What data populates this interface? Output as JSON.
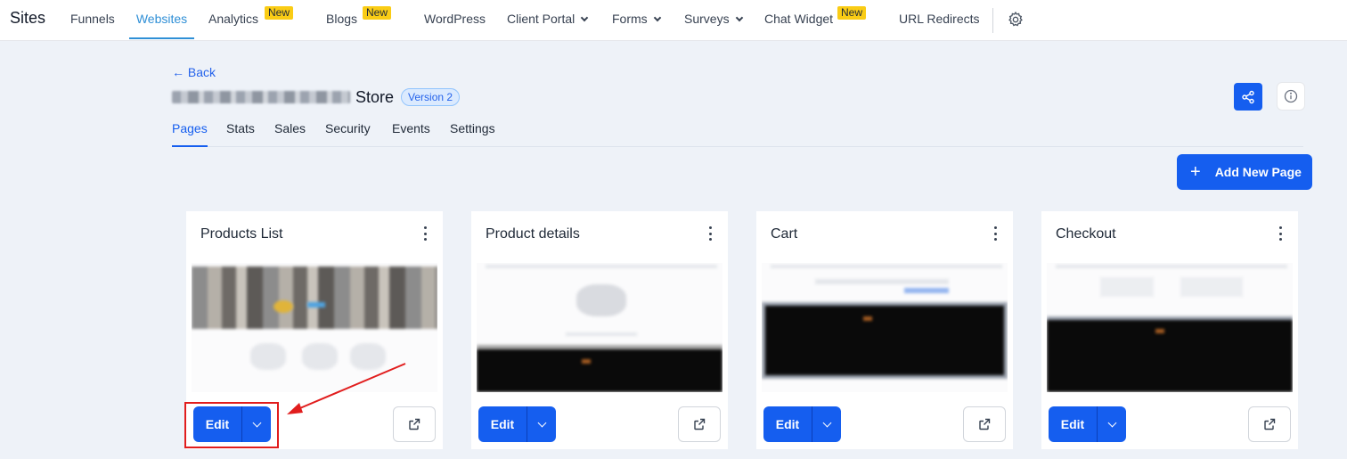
{
  "nav": {
    "brand": "Sites",
    "items": [
      {
        "label": "Funnels"
      },
      {
        "label": "Websites",
        "active": true
      },
      {
        "label": "Analytics",
        "badge": "New"
      },
      {
        "label": "Blogs",
        "badge": "New"
      },
      {
        "label": "WordPress"
      },
      {
        "label": "Client Portal",
        "dropdown": true
      },
      {
        "label": "Forms",
        "dropdown": true
      },
      {
        "label": "Surveys",
        "dropdown": true
      },
      {
        "label": "Chat Widget",
        "badge": "New"
      },
      {
        "label": "URL Redirects"
      }
    ],
    "settings_icon": "gear-icon"
  },
  "header": {
    "back_label": "← Back",
    "site_name_suffix": "Store",
    "version": "Version 2",
    "share_icon": "share-icon",
    "info_icon": "info-icon"
  },
  "tabs": [
    {
      "label": "Pages",
      "active": true
    },
    {
      "label": "Stats"
    },
    {
      "label": "Sales"
    },
    {
      "label": "Security"
    },
    {
      "label": "Events"
    },
    {
      "label": "Settings"
    }
  ],
  "actions": {
    "add_page_plus": "+",
    "add_page_label": "Add New Page"
  },
  "cards": [
    {
      "title": "Products List",
      "edit_label": "Edit"
    },
    {
      "title": "Product details",
      "edit_label": "Edit"
    },
    {
      "title": "Cart",
      "edit_label": "Edit"
    },
    {
      "title": "Checkout",
      "edit_label": "Edit"
    }
  ],
  "colors": {
    "primary": "#155eef",
    "active_nav": "#2f8fd6",
    "badge": "#facc15",
    "annotation": "#e11d1d",
    "background": "#eef2f8"
  }
}
